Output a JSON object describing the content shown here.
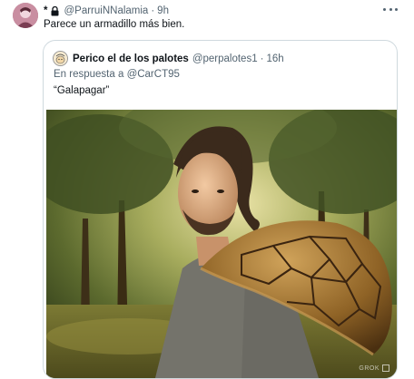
{
  "tweet": {
    "name": "*",
    "handle": "@ParruiNNalamia",
    "separator": "·",
    "time": "9h",
    "text": "Parece un armadillo más bien.",
    "icons": {
      "lock": "lock-icon",
      "more": "more-icon"
    }
  },
  "quote": {
    "name": "Perico el de los palotes",
    "handle": "@perpalotes1",
    "separator": "·",
    "time": "16h",
    "reply_prefix": "En respuesta a",
    "reply_mention": "@CarCT95",
    "text": "“Galapagar”",
    "image_badge": "GROK"
  },
  "colors": {
    "text": "#0f1419",
    "secondary": "#536471",
    "border": "#cfd9de"
  }
}
